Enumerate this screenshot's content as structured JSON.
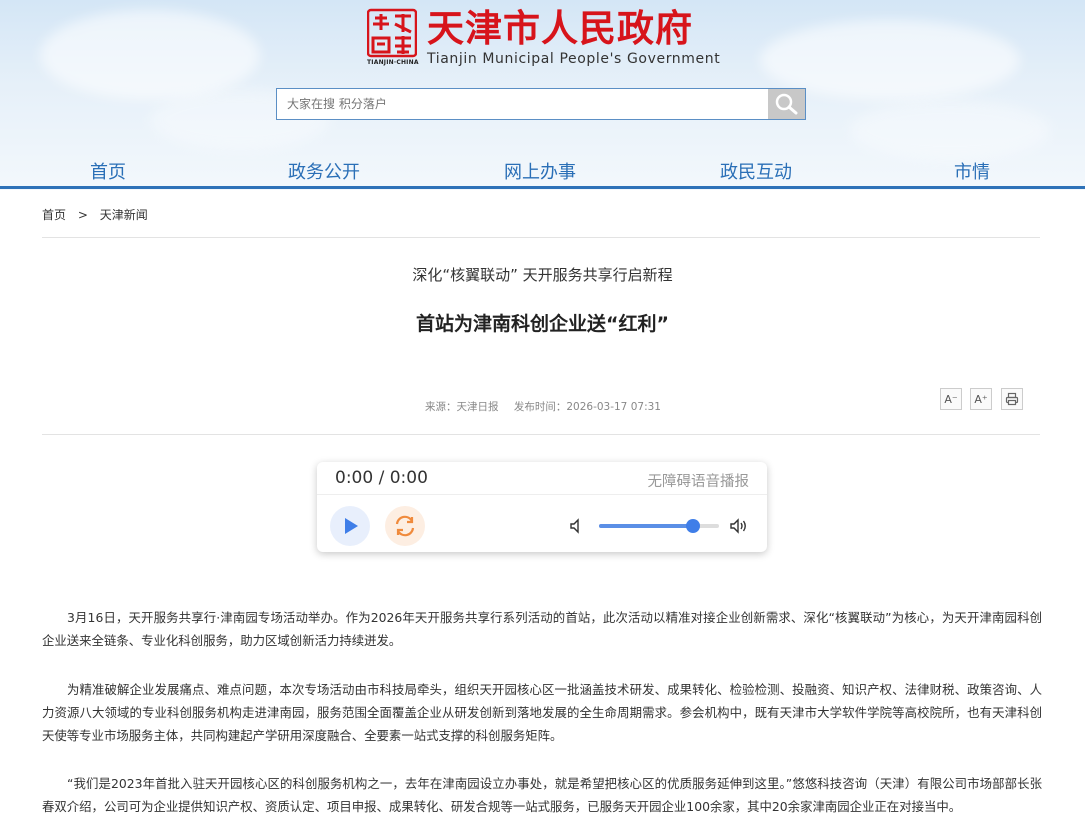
{
  "header": {
    "logo_seal_text": "联通天津",
    "logo_seal_caption": "TIANJIN·CHINA",
    "title_zh": "天津市人民政府",
    "title_en": "Tianjin Municipal People's Government",
    "search_placeholder": "大家在搜 积分落户",
    "search_icon": "magnifier-icon"
  },
  "nav": {
    "items": [
      {
        "label": "首页"
      },
      {
        "label": "政务公开"
      },
      {
        "label": "网上办事"
      },
      {
        "label": "政民互动"
      },
      {
        "label": "市情"
      }
    ]
  },
  "breadcrumb": {
    "home": "首页",
    "separator": ">",
    "current": "天津新闻"
  },
  "article": {
    "subtitle": "深化“核翼联动” 天开服务共享行启新程",
    "title": "首站为津南科创企业送“红利”",
    "source": "来源：天津日报",
    "publish_time": "发布时间：2026-03-17 07:31",
    "tools": {
      "font_smaller": "A⁻",
      "font_larger": "A⁺",
      "print_icon": "printer-icon"
    },
    "paragraphs": [
      "3月16日，天开服务共享行·津南园专场活动举办。作为2026年天开服务共享行系列活动的首站，此次活动以精准对接企业创新需求、深化“核翼联动”为核心，为天开津南园科创企业送来全链条、专业化科创服务，助力区域创新活力持续迸发。",
      "为精准破解企业发展痛点、难点问题，本次专场活动由市科技局牵头，组织天开园核心区一批涵盖技术研发、成果转化、检验检测、投融资、知识产权、法律财税、政策咨询、人力资源八大领域的专业科创服务机构走进津南园，服务范围全面覆盖企业从研发创新到落地发展的全生命周期需求。参会机构中，既有天津市大学软件学院等高校院所，也有天津科创天使等专业市场服务主体，共同构建起产学研用深度融合、全要素一站式支撑的科创服务矩阵。",
      "“我们是2023年首批入驻天开园核心区的科创服务机构之一，去年在津南园设立办事处，就是希望把核心区的优质服务延伸到这里。”悠悠科技咨询（天津）有限公司市场部部长张春双介绍，公司可为企业提供知识产权、资质认定、项目申报、成果转化、研发合规等一站式服务，已服务天开园企业100余家，其中20余家津南园企业正在对接当中。"
    ]
  },
  "player": {
    "time": "0:00 / 0:00",
    "label": "无障碍语音播报",
    "volume_fraction": 0.78,
    "colors": {
      "accent": "#3f7ee8",
      "reload": "#f08a3c"
    }
  },
  "colors": {
    "brand_red": "#d7141b",
    "nav_blue": "#2a6fb7",
    "nav_line": "#2e72b8"
  }
}
